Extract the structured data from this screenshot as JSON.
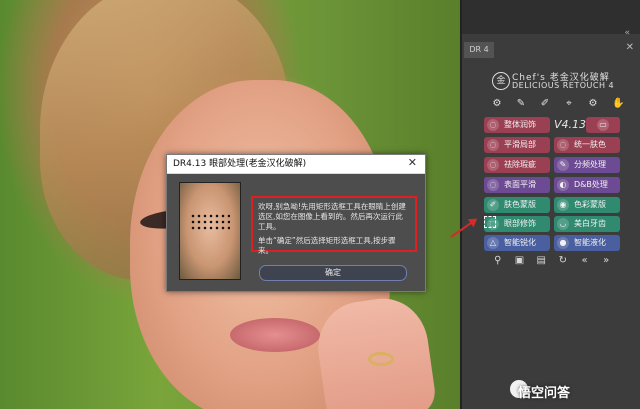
{
  "dialog": {
    "title": "DR4.13 眼部处理(老金汉化破解)",
    "close_glyph": "✕",
    "message_1": "欢呀,别急呦!先用矩形选框工具在眼睛上创建选区,如您在图像上看到的。然后再次运行此工具。",
    "message_2": "单击“确定”然后选择矩形选框工具,按步骤来。",
    "ok_label": "确定"
  },
  "panel": {
    "tab_label": "DR 4",
    "close_glyph": "✕",
    "collapse_glyph": "«",
    "logo_glyph": "金",
    "brand_line1": "Chef's 老金汉化破解",
    "brand_line2": "DELICIOUS RETOUCH 4",
    "version": "V4.13",
    "top_tools": [
      {
        "icon": "sliders-icon",
        "glyph": "⚙"
      },
      {
        "icon": "brush-icon",
        "glyph": "✎"
      },
      {
        "icon": "pen-icon",
        "glyph": "✐"
      },
      {
        "icon": "eyedropper-icon",
        "glyph": "⌖"
      },
      {
        "icon": "settings-icon",
        "glyph": "⚙"
      },
      {
        "icon": "hand-icon",
        "glyph": "✋"
      }
    ],
    "buttons": [
      {
        "label": "整体润饰",
        "color": "#9b3f52",
        "icon": "lasso-icon"
      },
      {
        "label": "平滑局部",
        "color": "#9b3f52",
        "icon": "lasso-icon"
      },
      {
        "label": "统一肤色",
        "color": "#9b3f52",
        "icon": "lasso-icon"
      },
      {
        "label": "祛除瑕疵",
        "color": "#9b3f52",
        "icon": "lasso-icon"
      },
      {
        "label": "分频处理",
        "color": "#6d4b94",
        "icon": "brush-icon"
      },
      {
        "label": "表面平滑",
        "color": "#6d4b94",
        "icon": "lasso-icon"
      },
      {
        "label": "D&B处理",
        "color": "#6d4b94",
        "icon": "dodge-icon"
      },
      {
        "label": "肤色蒙版",
        "color": "#2f8a6f",
        "icon": "pen-icon"
      },
      {
        "label": "色彩蒙版",
        "color": "#2f8a6f",
        "icon": "circle-icon"
      },
      {
        "label": "眼部修饰",
        "color": "#2f8a6f",
        "icon": "marquee-icon"
      },
      {
        "label": "美白牙齿",
        "color": "#2f8a6f",
        "icon": "lips-icon"
      },
      {
        "label": "智能锐化",
        "color": "#4a5fa0",
        "icon": "triangle-icon"
      },
      {
        "label": "智能液化",
        "color": "#4a5fa0",
        "icon": "blob-icon"
      }
    ],
    "bottom_tools": [
      {
        "icon": "zoom-icon",
        "glyph": "⚲"
      },
      {
        "icon": "window-icon",
        "glyph": "▣"
      },
      {
        "icon": "layers-icon",
        "glyph": "▤"
      },
      {
        "icon": "refresh-icon",
        "glyph": "↻"
      },
      {
        "icon": "back-icon",
        "glyph": "«"
      },
      {
        "icon": "forward-icon",
        "glyph": "»"
      }
    ]
  },
  "watermark": "悟空问答"
}
